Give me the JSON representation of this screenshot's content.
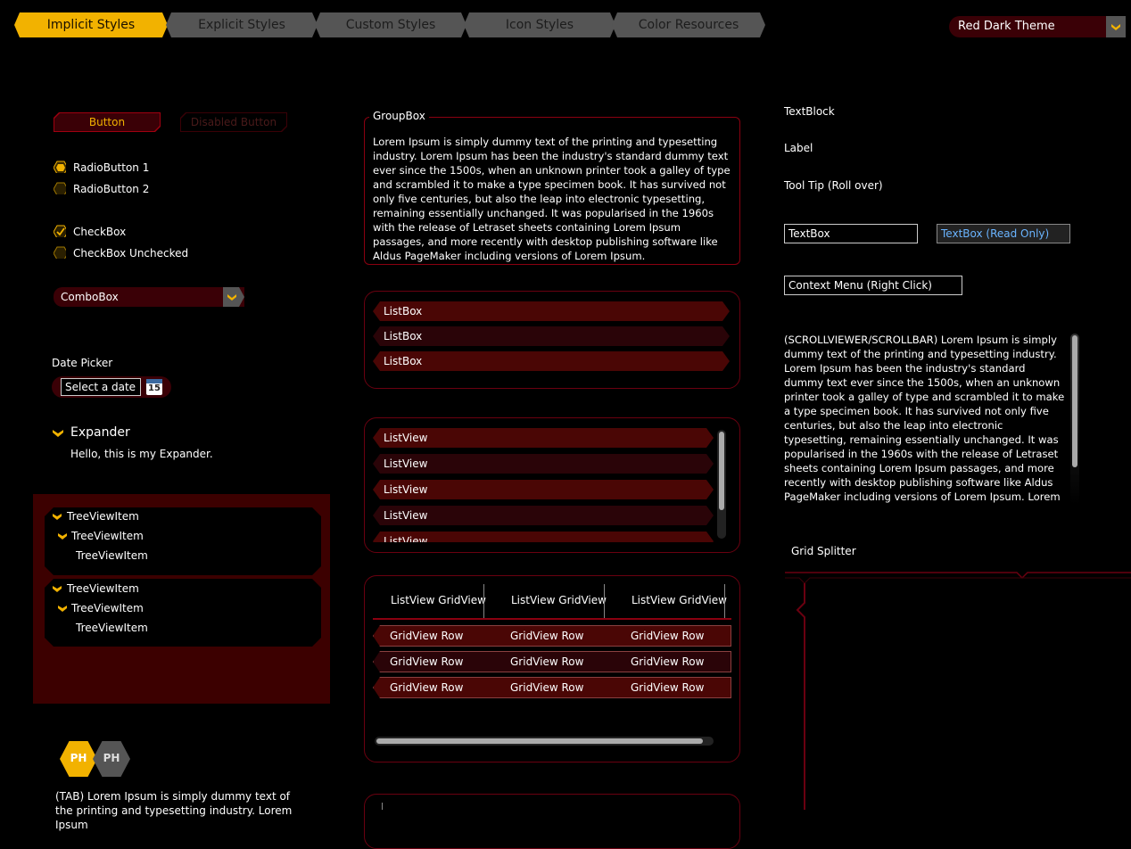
{
  "tabs": [
    "Implicit Styles",
    "Explicit Styles",
    "Custom Styles",
    "Icon Styles",
    "Color Resources"
  ],
  "theme": {
    "selected": "Red Dark Theme"
  },
  "buttons": {
    "button": "Button",
    "disabled": "Disabled Button"
  },
  "radios": [
    "RadioButton 1",
    "RadioButton 2"
  ],
  "checkboxes": [
    "CheckBox",
    "CheckBox Unchecked"
  ],
  "combobox": {
    "value": "ComboBox"
  },
  "datepicker": {
    "label": "Date Picker",
    "placeholder": "Select a date",
    "day": "15"
  },
  "expander": {
    "header": "Expander",
    "content": "Hello, this is my Expander."
  },
  "tree": {
    "item": "TreeViewItem"
  },
  "tabs_sample": {
    "header_a": "PH",
    "header_b": "PH",
    "text": "(TAB) Lorem Ipsum is simply dummy text of the printing and typesetting industry. Lorem Ipsum"
  },
  "groupbox": {
    "header": "GroupBox",
    "text": "Lorem Ipsum is simply dummy text of the printing and typesetting industry. Lorem Ipsum has been the industry's standard dummy text ever since the 1500s, when an unknown printer took a galley of type and scrambled it to make a type specimen book. It has survived not only five centuries, but also the leap into electronic typesetting, remaining essentially unchanged. It was popularised in the 1960s with the release of Letraset sheets containing Lorem Ipsum passages, and more recently with desktop publishing software like Aldus PageMaker including versions of Lorem Ipsum."
  },
  "listbox": [
    "ListBox",
    "ListBox",
    "ListBox"
  ],
  "listview": [
    "ListView",
    "ListView",
    "ListView",
    "ListView",
    "ListView"
  ],
  "gridview": {
    "headers": [
      "ListView GridView",
      "ListView GridView",
      "ListView GridView"
    ],
    "cell": "GridView Row"
  },
  "right": {
    "textblock": "TextBlock",
    "label": "Label",
    "tooltip": "Tool Tip (Roll over)",
    "textbox": "TextBox",
    "textbox_ro": "TextBox (Read Only)",
    "context": "Context Menu (Right Click)",
    "scroll_text": "(SCROLLVIEWER/SCROLLBAR) Lorem Ipsum is simply dummy text of the printing and typesetting industry. Lorem Ipsum has been the industry's standard dummy text ever since the 1500s, when an unknown printer took a galley of type and scrambled it to make a type specimen book. It has survived not only five centuries, but also the leap into electronic typesetting, remaining essentially unchanged. It was popularised in the 1960s with the release of Letraset sheets containing Lorem Ipsum passages, and more recently with desktop publishing software like Aldus PageMaker including versions of Lorem Ipsum. Lorem Ipsum is simply dummy text of the printing and typesetting",
    "splitter": "Grid Splitter"
  },
  "colors": {
    "accent": "#f2b200",
    "dark_red": "#4a0605",
    "border_red": "#a00010",
    "panel": "#3c0000"
  }
}
